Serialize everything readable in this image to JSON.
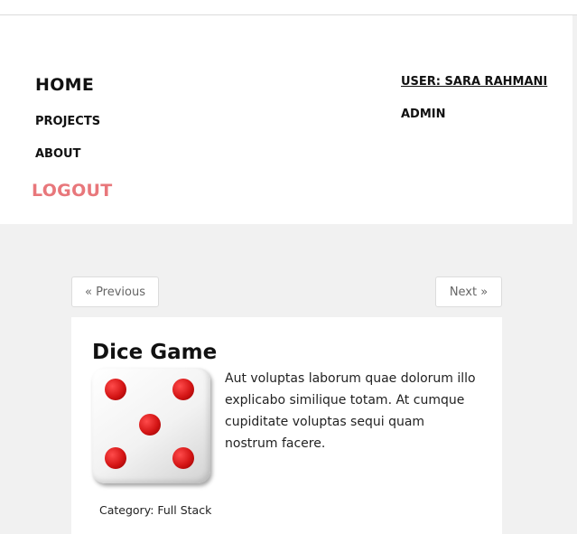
{
  "nav": {
    "home": "HOME",
    "projects": "PROJECTS",
    "about": "ABOUT",
    "logout": "LOGOUT",
    "user": "USER: SARA RAHMANI",
    "admin": "ADMIN",
    "logout_color": "#e8777b"
  },
  "pager": {
    "previous": "« Previous",
    "next": "Next »"
  },
  "project": {
    "title": "Dice Game",
    "image": "dice-five-image",
    "description": "Aut voluptas laborum quae dolorum illo explicabo similique totam. At cumque cupiditate voluptas sequi quam nostrum facere.",
    "category": "Category: Full Stack"
  }
}
